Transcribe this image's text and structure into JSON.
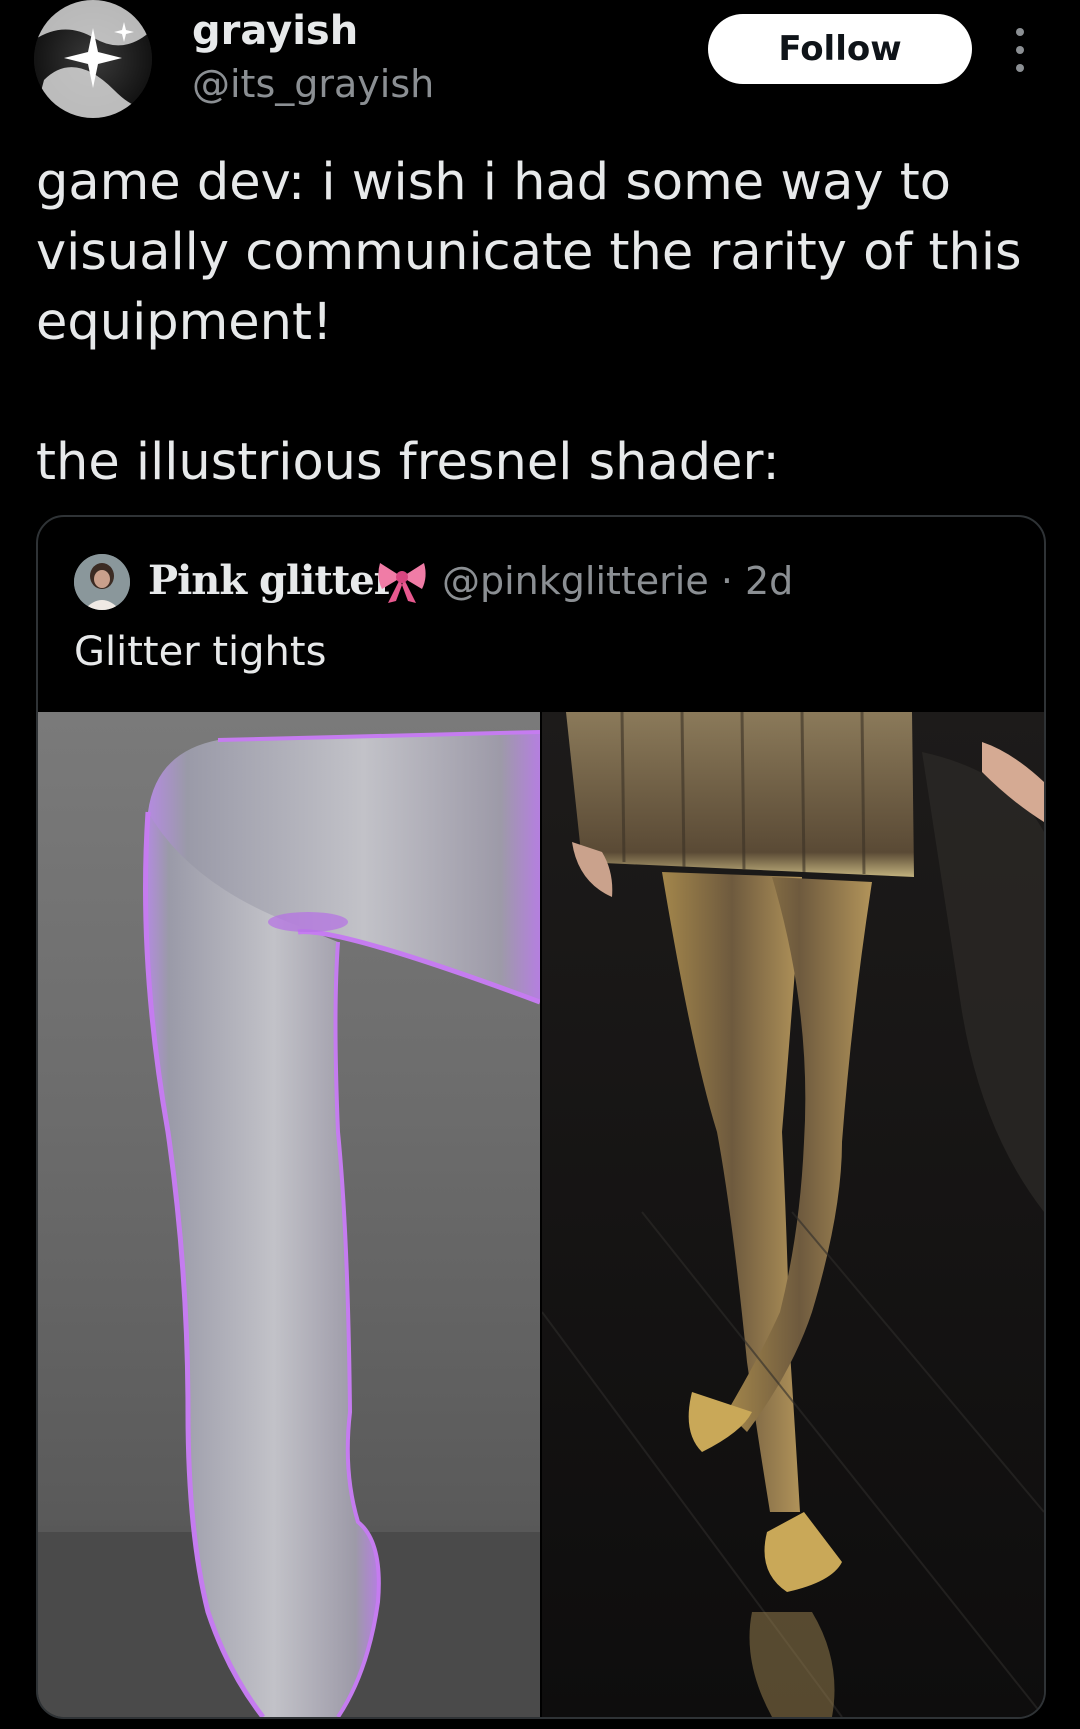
{
  "author": {
    "display_name": "grayish",
    "handle": "@its_grayish"
  },
  "actions": {
    "follow_label": "Follow"
  },
  "tweet": {
    "line1": "game dev: i wish i had some way to",
    "line2": "visually communicate the rarity of this",
    "line3": "equipment!",
    "line4": "the illustrious fresnel shader:"
  },
  "quote": {
    "display_name": "Pink glitter",
    "emoji_icon": "pink-bow-icon",
    "handle_time": "@pinkglitterie · 2d",
    "text": "Glitter tights",
    "media": [
      "lavender-glitter-tights-photo",
      "gold-glitter-tights-runway-photo"
    ]
  },
  "colors": {
    "background": "#000000",
    "text": "#e7e9ea",
    "secondary_text": "#8b8f93",
    "border": "#2f3336",
    "follow_bg": "#ffffff"
  }
}
